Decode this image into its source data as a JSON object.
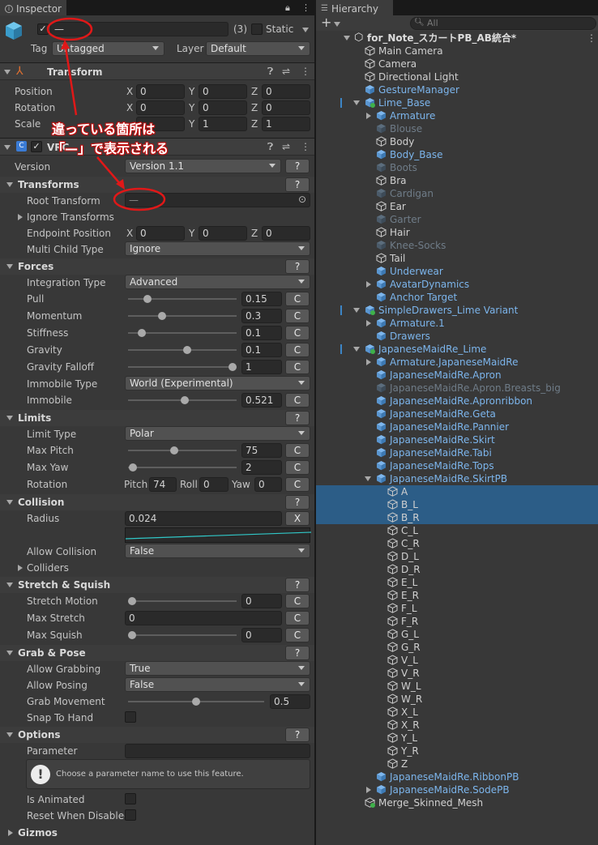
{
  "inspector": {
    "tab_label": "Inspector",
    "object": {
      "name_value": "—",
      "count": "(3)",
      "static_label": "Static",
      "tag_label": "Tag",
      "tag_value": "Untagged",
      "layer_label": "Layer",
      "layer_value": "Default"
    },
    "transform": {
      "title": "Transform",
      "rows": [
        {
          "label": "Position",
          "x": "0",
          "y": "0",
          "z": "0"
        },
        {
          "label": "Rotation",
          "x": "0",
          "y": "0",
          "z": "0"
        },
        {
          "label": "Scale",
          "x": "",
          "y": "1",
          "z": "1"
        }
      ],
      "axis_x": "X",
      "axis_y": "Y",
      "axis_z": "Z"
    },
    "vrc": {
      "title": "VRC",
      "version_label": "Version",
      "version_value": "Version 1.1",
      "help": "?",
      "transforms": {
        "title": "Transforms",
        "root_transform_label": "Root Transform",
        "root_transform_value": "—",
        "ignore_transforms_label": "Ignore Transforms",
        "endpoint_label": "Endpoint Position",
        "endpoint": {
          "x": "0",
          "y": "0",
          "z": "0"
        },
        "multi_child_label": "Multi Child Type",
        "multi_child_value": "Ignore"
      },
      "forces": {
        "title": "Forces",
        "integration_label": "Integration Type",
        "integration_value": "Advanced",
        "pull_label": "Pull",
        "pull_value": "0.15",
        "pull_level": 0.15,
        "momentum_label": "Momentum",
        "momentum_value": "0.3",
        "momentum_level": 0.3,
        "stiffness_label": "Stiffness",
        "stiffness_value": "0.1",
        "stiffness_level": 0.1,
        "gravity_label": "Gravity",
        "gravity_value": "0.1",
        "gravity_level": 0.55,
        "gravity_falloff_label": "Gravity Falloff",
        "gravity_falloff_value": "1",
        "gravity_falloff_level": 1.0,
        "immobile_type_label": "Immobile Type",
        "immobile_type_value": "World (Experimental)",
        "immobile_label": "Immobile",
        "immobile_value": "0.521",
        "immobile_level": 0.521,
        "curve_button": "C"
      },
      "limits": {
        "title": "Limits",
        "limit_type_label": "Limit Type",
        "limit_type_value": "Polar",
        "max_pitch_label": "Max Pitch",
        "max_pitch_value": "75",
        "max_pitch_level": 0.42,
        "max_yaw_label": "Max Yaw",
        "max_yaw_value": "2",
        "max_yaw_level": 0.01,
        "rotation_label": "Rotation",
        "pitch_label": "Pitch",
        "pitch_value": "74",
        "roll_label": "Roll",
        "roll_value": "0",
        "yaw_label": "Yaw",
        "yaw_value": "0"
      },
      "collision": {
        "title": "Collision",
        "radius_label": "Radius",
        "radius_value": "0.024",
        "radius_button": "X",
        "allow_collision_label": "Allow Collision",
        "allow_collision_value": "False",
        "colliders_label": "Colliders"
      },
      "stretch": {
        "title": "Stretch & Squish",
        "stretch_motion_label": "Stretch Motion",
        "stretch_motion_value": "0",
        "stretch_motion_level": 0.0,
        "max_stretch_label": "Max Stretch",
        "max_stretch_value": "0",
        "max_squish_label": "Max Squish",
        "max_squish_value": "0",
        "max_squish_level": 0.0
      },
      "grab": {
        "title": "Grab & Pose",
        "allow_grabbing_label": "Allow Grabbing",
        "allow_grabbing_value": "True",
        "allow_posing_label": "Allow Posing",
        "allow_posing_value": "False",
        "grab_movement_label": "Grab Movement",
        "grab_movement_value": "0.5",
        "grab_movement_level": 0.5,
        "snap_label": "Snap To Hand"
      },
      "options": {
        "title": "Options",
        "parameter_label": "Parameter",
        "parameter_value": "",
        "help_text": "Choose a parameter name to use this feature.",
        "is_animated_label": "Is Animated",
        "reset_label": "Reset When Disabled"
      },
      "gizmos_label": "Gizmos"
    },
    "annotation": {
      "line1": "違っている箇所は",
      "line2": "「—」で表示される"
    }
  },
  "hierarchy": {
    "tab_label": "Hierarchy",
    "search_placeholder": "All",
    "scene_name": "for_Note_スカートPB_AB統合*",
    "items": [
      {
        "label": "Main Camera"
      },
      {
        "label": "Camera"
      },
      {
        "label": "Directional Light"
      },
      {
        "label": "GestureManager"
      },
      {
        "label": "Lime_Base"
      },
      {
        "label": "Armature"
      },
      {
        "label": "Blouse"
      },
      {
        "label": "Body"
      },
      {
        "label": "Body_Base"
      },
      {
        "label": "Boots"
      },
      {
        "label": "Bra"
      },
      {
        "label": "Cardigan"
      },
      {
        "label": "Ear"
      },
      {
        "label": "Garter"
      },
      {
        "label": "Hair"
      },
      {
        "label": "Knee-Socks"
      },
      {
        "label": "Tail"
      },
      {
        "label": "Underwear"
      },
      {
        "label": "AvatarDynamics"
      },
      {
        "label": "Anchor Target"
      },
      {
        "label": "SimpleDrawers_Lime Variant"
      },
      {
        "label": "Armature.1"
      },
      {
        "label": "Drawers"
      },
      {
        "label": "JapaneseMaidRe_Lime"
      },
      {
        "label": "Armature.JapaneseMaidRe"
      },
      {
        "label": "JapaneseMaidRe.Apron"
      },
      {
        "label": "JapaneseMaidRe.Apron.Breasts_big"
      },
      {
        "label": "JapaneseMaidRe.Apronribbon"
      },
      {
        "label": "JapaneseMaidRe.Geta"
      },
      {
        "label": "JapaneseMaidRe.Pannier"
      },
      {
        "label": "JapaneseMaidRe.Skirt"
      },
      {
        "label": "JapaneseMaidRe.Tabi"
      },
      {
        "label": "JapaneseMaidRe.Tops"
      },
      {
        "label": "JapaneseMaidRe.SkirtPB"
      },
      {
        "label": "A"
      },
      {
        "label": "B_L"
      },
      {
        "label": "B_R"
      },
      {
        "label": "C_L"
      },
      {
        "label": "C_R"
      },
      {
        "label": "D_L"
      },
      {
        "label": "D_R"
      },
      {
        "label": "E_L"
      },
      {
        "label": "E_R"
      },
      {
        "label": "F_L"
      },
      {
        "label": "F_R"
      },
      {
        "label": "G_L"
      },
      {
        "label": "G_R"
      },
      {
        "label": "V_L"
      },
      {
        "label": "V_R"
      },
      {
        "label": "W_L"
      },
      {
        "label": "W_R"
      },
      {
        "label": "X_L"
      },
      {
        "label": "X_R"
      },
      {
        "label": "Y_L"
      },
      {
        "label": "Y_R"
      },
      {
        "label": "Z"
      },
      {
        "label": "JapaneseMaidRe.RibbonPB"
      },
      {
        "label": "JapaneseMaidRe.SodePB"
      },
      {
        "label": "Merge_Skinned_Mesh"
      }
    ]
  },
  "colors": {
    "accent_selected": "#2c5d87",
    "prefab_blue": "#7cb5ec",
    "annotation_red": "#e01818"
  }
}
